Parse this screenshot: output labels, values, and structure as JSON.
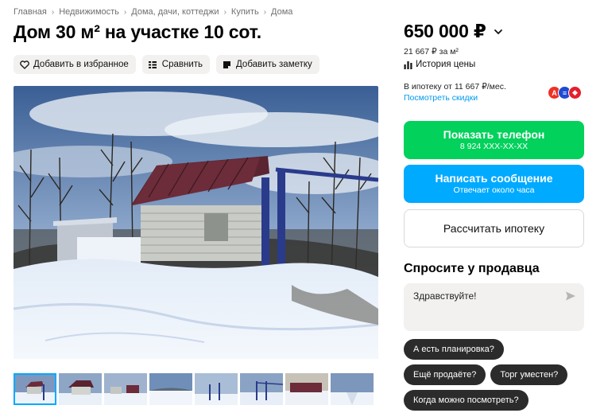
{
  "breadcrumbs": [
    "Главная",
    "Недвижимость",
    "Дома, дачи, коттеджи",
    "Купить",
    "Дома"
  ],
  "title": "Дом 30 м² на участке 10 сот.",
  "actions": {
    "favorite": "Добавить в избранное",
    "compare": "Сравнить",
    "note": "Добавить заметку"
  },
  "gallery": {
    "thumbnail_count": 8,
    "active_index": 0
  },
  "price": {
    "value": "650 000 ₽",
    "per_m2": "21 667 ₽ за м²",
    "history_label": "История цены"
  },
  "mortgage": {
    "text": "В ипотеку от 11 667 ₽/мес.",
    "link": "Посмотреть скидки",
    "banks": [
      {
        "name": "alfa-bank",
        "letter": "А",
        "color": "#ef3124"
      },
      {
        "name": "vtb",
        "letter": "≡",
        "color": "#1e4bd2"
      },
      {
        "name": "sovcombank",
        "letter": "◆",
        "color": "#e4202c"
      }
    ]
  },
  "contact": {
    "phone_label": "Показать телефон",
    "phone_masked": "8 924 XXX-XX-XX",
    "message_label": "Написать сообщение",
    "message_sub": "Отвечает около часа",
    "mortgage_calc": "Рассчитать ипотеку"
  },
  "ask_seller": {
    "title": "Спросите у продавца",
    "message_value": "Здравствуйте!",
    "quick_questions": [
      "А есть планировка?",
      "Ещё продаёте?",
      "Торг уместен?",
      "Когда можно посмотреть?"
    ]
  },
  "colors": {
    "green": "#02d15c",
    "blue": "#00aaff",
    "link": "#0099ee",
    "chip": "#2b2b2b"
  }
}
